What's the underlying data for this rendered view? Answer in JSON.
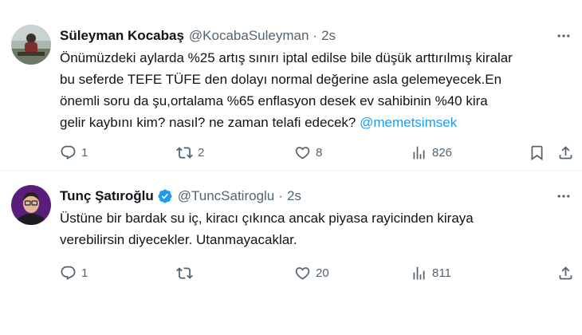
{
  "colors": {
    "accent": "#1d9bf0",
    "muted": "#536471",
    "text": "#0f1419",
    "divider": "#eff3f4"
  },
  "tweets": [
    {
      "name": "Süleyman Kocabaş",
      "handle": "@KocabaSuleyman",
      "separator": "·",
      "time": "2s",
      "verified": false,
      "text": "Önümüzdeki aylarda %25 artış sınırı iptal edilse bile düşük arttırılmış kiralar\nbu seferde TEFE TÜFE den dolayı normal değerine asla gelemeyecek.En\nönemli soru da şu,ortalama %65 enflasyon desek ev sahibinin %40 kira\ngelir kaybını kim? nasıl? ne zaman telafi edecek? ",
      "mention": "@memetsimsek",
      "replies": "1",
      "retweets": "2",
      "likes": "8",
      "views": "826"
    },
    {
      "name": "Tunç Şatıroğlu",
      "handle": "@TuncSatiroglu",
      "separator": "·",
      "time": "2s",
      "verified": true,
      "text": "Üstüne bir bardak su iç, kiracı çıkınca ancak piyasa rayicinden kiraya\nverebilirsin diyecekler. Utanmayacaklar.",
      "mention": "",
      "replies": "1",
      "retweets": "",
      "likes": "20",
      "views": "811"
    }
  ]
}
